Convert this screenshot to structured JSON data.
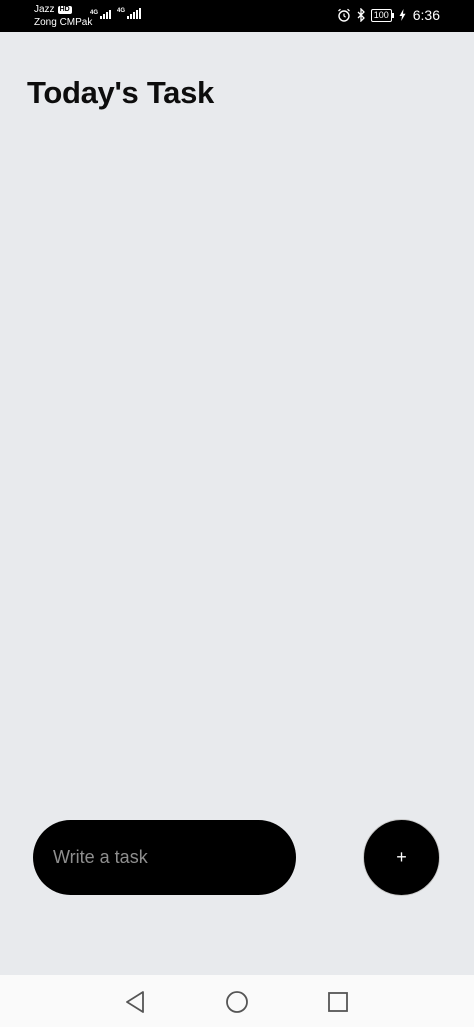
{
  "status_bar": {
    "carrier_1": "Jazz",
    "carrier_1_badge": "HD",
    "carrier_2": "Zong CMPak",
    "network_1": "4G",
    "network_2": "4G",
    "battery": "100",
    "time": "6:36"
  },
  "header": {
    "title": "Today's Task"
  },
  "composer": {
    "placeholder": "Write a task",
    "value": "",
    "add_label": "+"
  },
  "icons": {
    "alarm": "alarm-icon",
    "bluetooth": "bluetooth-icon",
    "charging": "charging-icon",
    "back": "nav-back-icon",
    "home": "nav-home-icon",
    "recents": "nav-recents-icon"
  }
}
